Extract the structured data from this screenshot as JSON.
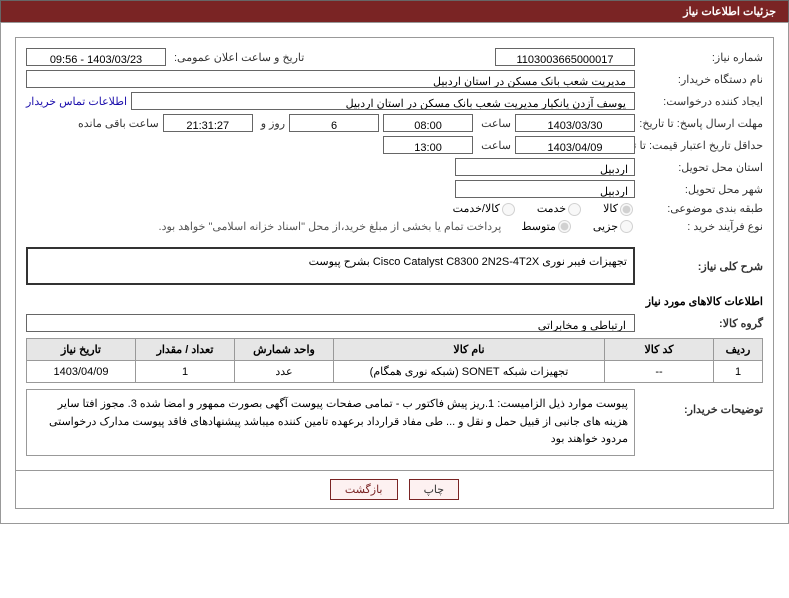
{
  "header": {
    "title": "جزئیات اطلاعات نیاز"
  },
  "fields": {
    "need_no_label": "شماره نیاز:",
    "need_no": "1103003665000017",
    "announce_label": "تاریخ و ساعت اعلان عمومی:",
    "announce_value": "1403/03/23 - 09:56",
    "buyer_label": "نام دستگاه خریدار:",
    "buyer_value": "مدیریت شعب بانک مسکن در استان اردبیل",
    "requester_label": "ایجاد کننده درخواست:",
    "requester_value": "یوسف  آزدن یانکیار مدیریت شعب بانک مسکن در استان اردبیل",
    "contact_link": "اطلاعات تماس خریدار",
    "deadline_resp_label": "مهلت ارسال پاسخ: تا تاریخ:",
    "deadline_resp_date": "1403/03/30",
    "hour_label": "ساعت",
    "deadline_resp_time": "08:00",
    "days_val": "6",
    "and_label": "روز و",
    "countdown": "21:31:27",
    "remaining_label": "ساعت باقی مانده",
    "validity_label": "حداقل تاریخ اعتبار قیمت: تا تاریخ:",
    "validity_date": "1403/04/09",
    "validity_time": "13:00",
    "deliver_province_label": "استان محل تحویل:",
    "deliver_province": "اردبیل",
    "deliver_city_label": "شهر محل تحویل:",
    "deliver_city": "اردبیل",
    "category_label": "طبقه بندی موضوعی:",
    "cat_opt1": "کالا",
    "cat_opt2": "خدمت",
    "cat_opt3": "کالا/خدمت",
    "purchase_type_label": "نوع فرآیند خرید :",
    "ptype_opt1": "جزیی",
    "ptype_opt2": "متوسط",
    "ptype_note": "پرداخت تمام یا بخشی از مبلغ خرید،از محل \"اسناد خزانه اسلامی\" خواهد بود.",
    "overall_label": "شرح کلی نیاز:",
    "overall_value": "تجهیزات فیبر نوری  Cisco Catalyst C8300 2N2S-4T2X بشرح پیوست",
    "goods_section": "اطلاعات کالاهای مورد نیاز",
    "group_label": "گروه کالا:",
    "group_value": "ارتباطی و مخابراتی",
    "explain_label": "توضیحات خریدار:",
    "explain_value": "پیوست موارد ذیل الزامیست: 1.ریز پیش فاکتور  ب - تمامی صفحات پیوست آگهی بصورت ممهور و امضا شده 3. مجوز افتا سایر هزینه های جانبی از قبیل حمل و نقل و ...  طی مفاد قرارداد برعهده تامین کننده میباشد پیشنهادهای فاقد پیوست مدارک درخواستی مردود خواهند بود"
  },
  "table": {
    "headers": [
      "ردیف",
      "کد کالا",
      "نام کالا",
      "واحد شمارش",
      "تعداد / مقدار",
      "تاریخ نیاز"
    ],
    "rows": [
      {
        "idx": "1",
        "code": "--",
        "name": "تجهیزات شبکه SONET (شبکه نوری همگام)",
        "unit": "عدد",
        "qty": "1",
        "need_date": "1403/04/09"
      }
    ]
  },
  "buttons": {
    "print": "چاپ",
    "back": "بازگشت"
  }
}
